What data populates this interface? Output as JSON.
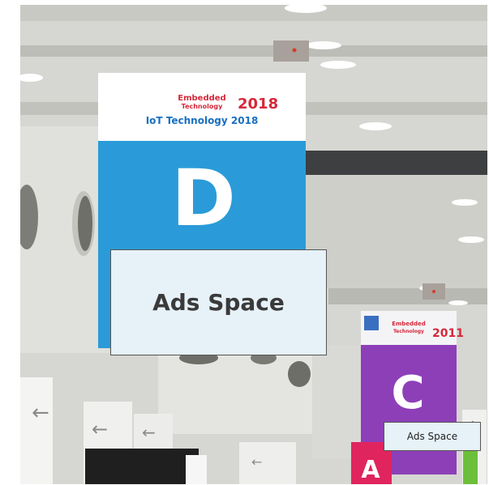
{
  "photo": {
    "banner_d": {
      "brand_line1": "Embedded",
      "brand_line2": "Technology",
      "brand_year": "2018",
      "brand_line3": "IoT Technology 2018",
      "letter": "D"
    },
    "banner_c": {
      "brand_line1": "Embedded",
      "brand_line2": "Technology",
      "brand_year": "2011",
      "letter": "C"
    },
    "banner_a": {
      "letter": "A"
    }
  },
  "ads": {
    "large_label": "Ads Space",
    "small_label": "Ads Space"
  },
  "colors": {
    "banner_d_blue": "#2a9bd8",
    "banner_c_purple": "#8d3fb8",
    "banner_a_red": "#e0245e",
    "ad_fill": "#e6f1f8",
    "ad_border": "#555555"
  }
}
